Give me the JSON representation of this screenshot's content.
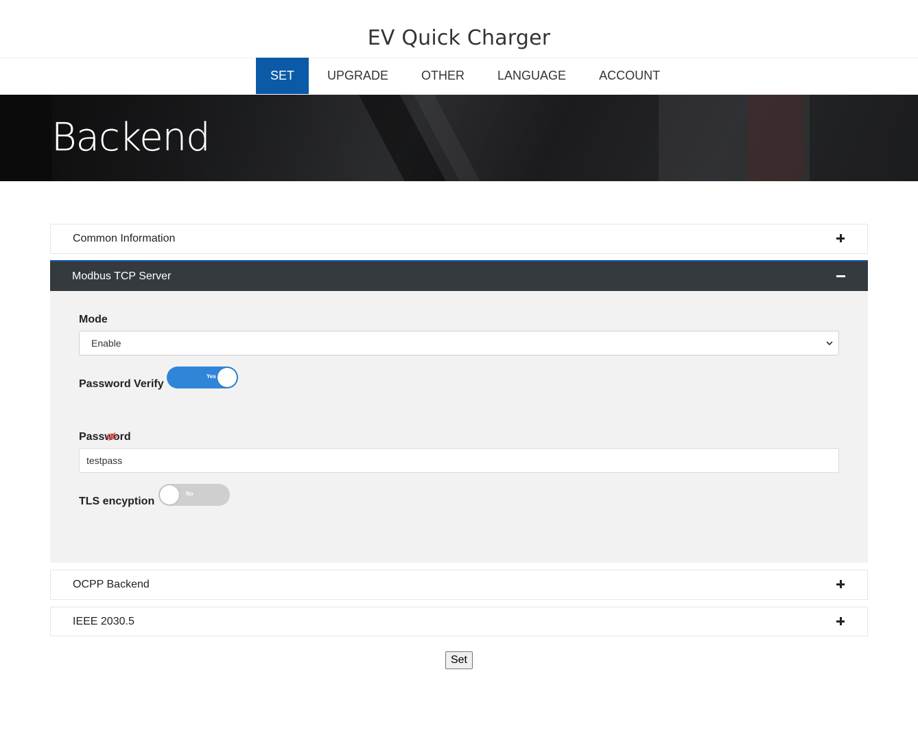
{
  "header": {
    "title": "EV Quick Charger"
  },
  "nav": {
    "items": [
      {
        "label": "SET",
        "active": true
      },
      {
        "label": "UPGRADE",
        "active": false
      },
      {
        "label": "OTHER",
        "active": false
      },
      {
        "label": "LANGUAGE",
        "active": false
      },
      {
        "label": "ACCOUNT",
        "active": false
      }
    ]
  },
  "hero": {
    "title": "Backend"
  },
  "sections": {
    "common": {
      "title": "Common Information",
      "expanded": false,
      "icon": "plus-icon"
    },
    "modbus": {
      "title": "Modbus TCP Server",
      "expanded": true,
      "icon": "minus-icon",
      "mode": {
        "label": "Mode",
        "value": "Enable"
      },
      "password_verify": {
        "label": "Password Verify",
        "state": "Yes"
      },
      "password": {
        "label": "Password",
        "value": "testpass",
        "icon": "eye-slash-icon"
      },
      "tls": {
        "label": "TLS encyption",
        "state": "No"
      }
    },
    "ocpp": {
      "title": "OCPP Backend",
      "expanded": false,
      "icon": "plus-icon"
    },
    "ieee": {
      "title": "IEEE 2030.5",
      "expanded": false,
      "icon": "plus-icon"
    }
  },
  "actions": {
    "set_label": "Set"
  },
  "colors": {
    "primary": "#0a5aa8",
    "toggle_on": "#2f86d8",
    "toggle_off": "#cfcfcf",
    "panel_header_dark": "#353a3f",
    "eye_icon": "#e04a4a"
  }
}
